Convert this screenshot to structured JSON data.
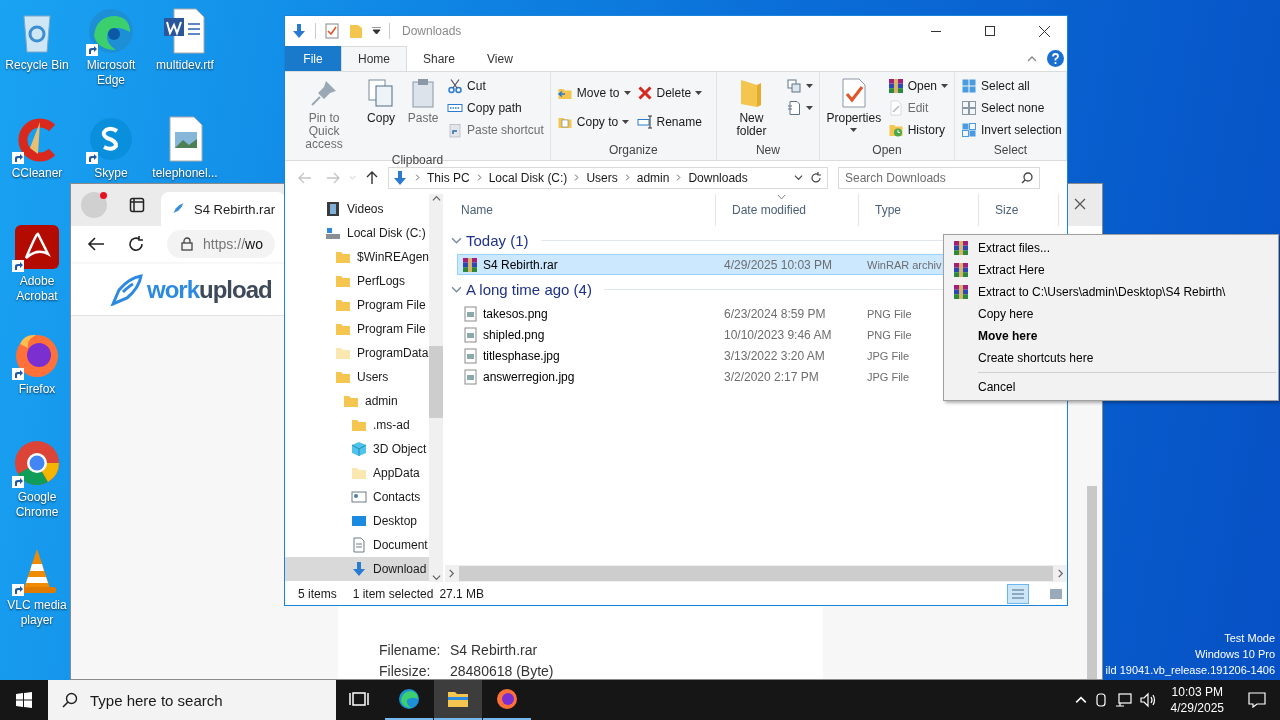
{
  "desktop": {
    "columns": [
      [
        {
          "label": "Recycle Bin",
          "shortcut": false
        },
        {
          "label": "CCleaner",
          "shortcut": true
        },
        {
          "label": "Adobe Acrobat",
          "shortcut": true
        },
        {
          "label": "Firefox",
          "shortcut": true
        },
        {
          "label": "Google Chrome",
          "shortcut": true
        },
        {
          "label": "VLC media player",
          "shortcut": true
        }
      ],
      [
        {
          "label": "Microsoft Edge",
          "shortcut": true
        },
        {
          "label": "Skype",
          "shortcut": true
        }
      ],
      [
        {
          "label": "multidev.rtf",
          "shortcut": false
        },
        {
          "label": "telephonel...",
          "shortcut": false
        }
      ]
    ]
  },
  "browser": {
    "profile": {
      "notification": true
    },
    "tab": {
      "title": "S4 Rebirth.rar"
    },
    "address": {
      "scheme": "https://",
      "host": "wo"
    },
    "site": {
      "logo_lead": "work",
      "logo_rest": "upload"
    },
    "file_info": [
      {
        "label": "Filename:",
        "value": "S4 Rebirth.rar"
      },
      {
        "label": "Filesize:",
        "value": "28480618 (Byte)"
      }
    ]
  },
  "explorer": {
    "title": "Downloads",
    "ribbon_tabs": [
      {
        "label": "File",
        "kind": "file",
        "selected": false
      },
      {
        "label": "Home",
        "kind": "tab",
        "selected": true
      },
      {
        "label": "Share",
        "kind": "tab",
        "selected": false
      },
      {
        "label": "View",
        "kind": "tab",
        "selected": false
      }
    ],
    "ribbon_groups": [
      {
        "label": "Clipboard",
        "commands": [
          {
            "label": "Pin to Quick access",
            "kind": "large",
            "disabled": true,
            "dropdown": false
          },
          {
            "label": "Copy",
            "kind": "large",
            "disabled": false,
            "dropdown": false
          },
          {
            "label": "Paste",
            "kind": "large",
            "disabled": true,
            "dropdown": false
          },
          {
            "label": "Cut",
            "kind": "small",
            "disabled": false,
            "dropdown": false
          },
          {
            "label": "Copy path",
            "kind": "small",
            "disabled": false,
            "dropdown": false
          },
          {
            "label": "Paste shortcut",
            "kind": "small",
            "disabled": true,
            "dropdown": false
          }
        ]
      },
      {
        "label": "Organize",
        "commands": [
          {
            "label": "Move to",
            "kind": "medium",
            "disabled": false,
            "dropdown": true
          },
          {
            "label": "Copy to",
            "kind": "medium",
            "disabled": false,
            "dropdown": true
          },
          {
            "label": "Delete",
            "kind": "medium",
            "disabled": false,
            "dropdown": true
          },
          {
            "label": "Rename",
            "kind": "medium",
            "disabled": false,
            "dropdown": false
          }
        ]
      },
      {
        "label": "New",
        "commands": [
          {
            "label": "New folder",
            "kind": "large",
            "disabled": false,
            "dropdown": false
          },
          {
            "kind": "small",
            "disabled": false,
            "dropdown": true
          },
          {
            "kind": "small",
            "disabled": false,
            "dropdown": true
          }
        ]
      },
      {
        "label": "Open",
        "commands": [
          {
            "label": "Properties",
            "kind": "large",
            "disabled": false,
            "dropdown": true
          },
          {
            "label": "Open",
            "kind": "small",
            "disabled": false,
            "dropdown": true
          },
          {
            "label": "Edit",
            "kind": "small",
            "disabled": true,
            "dropdown": false
          },
          {
            "label": "History",
            "kind": "small",
            "disabled": false,
            "dropdown": false
          }
        ]
      },
      {
        "label": "Select",
        "commands": [
          {
            "label": "Select all",
            "kind": "small",
            "disabled": false,
            "dropdown": false
          },
          {
            "label": "Select none",
            "kind": "small",
            "disabled": false,
            "dropdown": false
          },
          {
            "label": "Invert selection",
            "kind": "small",
            "disabled": false,
            "dropdown": false
          }
        ]
      }
    ],
    "nav": {
      "back_disabled": true,
      "forward_disabled": true
    },
    "breadcrumbs": [
      "This PC",
      "Local Disk (C:)",
      "Users",
      "admin",
      "Downloads"
    ],
    "search": {
      "placeholder": "Search Downloads"
    },
    "tree": [
      {
        "label": "Videos",
        "kind": "videos",
        "selected": false
      },
      {
        "label": "Local Disk (C:)",
        "kind": "drive",
        "selected": false,
        "children": [
          {
            "label": "$WinREAgen",
            "kind": "folder",
            "selected": false
          },
          {
            "label": "PerfLogs",
            "kind": "folder",
            "selected": false
          },
          {
            "label": "Program File",
            "kind": "folder",
            "selected": false
          },
          {
            "label": "Program File",
            "kind": "folder",
            "selected": false
          },
          {
            "label": "ProgramData",
            "kind": "hidden",
            "selected": false
          },
          {
            "label": "Users",
            "kind": "folder",
            "selected": false,
            "children": [
              {
                "label": "admin",
                "kind": "folder",
                "selected": false,
                "children": [
                  {
                    "label": ".ms-ad",
                    "kind": "folder",
                    "selected": false
                  },
                  {
                    "label": "3D Object",
                    "kind": "cube",
                    "selected": false
                  },
                  {
                    "label": "AppData",
                    "kind": "hidden",
                    "selected": false
                  },
                  {
                    "label": "Contacts",
                    "kind": "contacts",
                    "selected": false
                  },
                  {
                    "label": "Desktop",
                    "kind": "desktop",
                    "selected": false
                  },
                  {
                    "label": "Document",
                    "kind": "document",
                    "selected": false
                  },
                  {
                    "label": "Download",
                    "kind": "download",
                    "selected": true
                  }
                ]
              }
            ]
          }
        ]
      }
    ],
    "columns": [
      "Name",
      "Date modified",
      "Type",
      "Size"
    ],
    "groups": [
      {
        "label": "Today (1)",
        "expanded": true,
        "files": [
          {
            "name": "S4 Rebirth.rar",
            "date": "4/29/2025 10:03 PM",
            "type": "WinRAR archiv",
            "kind": "rar",
            "selected": true
          }
        ]
      },
      {
        "label": "A long time ago (4)",
        "expanded": true,
        "files": [
          {
            "name": "takesos.png",
            "date": "6/23/2024 8:59 PM",
            "type": "PNG File",
            "kind": "image",
            "selected": false
          },
          {
            "name": "shipled.png",
            "date": "10/10/2023 9:46 AM",
            "type": "PNG File",
            "kind": "image",
            "selected": false
          },
          {
            "name": "titlesphase.jpg",
            "date": "3/13/2022 3:20 AM",
            "type": "JPG File",
            "kind": "image",
            "selected": false
          },
          {
            "name": "answerregion.jpg",
            "date": "3/2/2020 2:17 PM",
            "type": "JPG File",
            "kind": "image",
            "selected": false
          }
        ]
      }
    ],
    "status": {
      "count": "5 items",
      "selection": "1 item selected",
      "size": "27.1 MB"
    },
    "views": [
      {
        "kind": "details",
        "selected": true
      },
      {
        "kind": "tiles",
        "selected": false
      }
    ]
  },
  "context_menu": [
    {
      "label": "Extract files...",
      "kind": "winrar"
    },
    {
      "label": "Extract Here",
      "kind": "winrar"
    },
    {
      "label": "Extract to C:\\Users\\admin\\Desktop\\S4 Rebirth\\",
      "kind": "winrar"
    },
    {
      "label": "Copy here",
      "kind": "plain"
    },
    {
      "label": "Move here",
      "kind": "default"
    },
    {
      "label": "Create shortcuts here",
      "kind": "plain"
    },
    {
      "kind": "separator"
    },
    {
      "label": "Cancel",
      "kind": "plain"
    }
  ],
  "system_watermark": [
    "Test Mode",
    "Windows 10 Pro",
    "ild 19041.vb_release.191206-1406"
  ],
  "taskbar": {
    "search_placeholder": "Type here to search",
    "apps": [
      {
        "kind": "taskview",
        "running": false,
        "selected": false
      },
      {
        "kind": "edge",
        "running": true,
        "selected": false
      },
      {
        "kind": "explorer",
        "running": true,
        "selected": true
      },
      {
        "kind": "firefox",
        "running": true,
        "selected": false
      }
    ],
    "time": "10:03 PM",
    "date": "4/29/2025"
  }
}
